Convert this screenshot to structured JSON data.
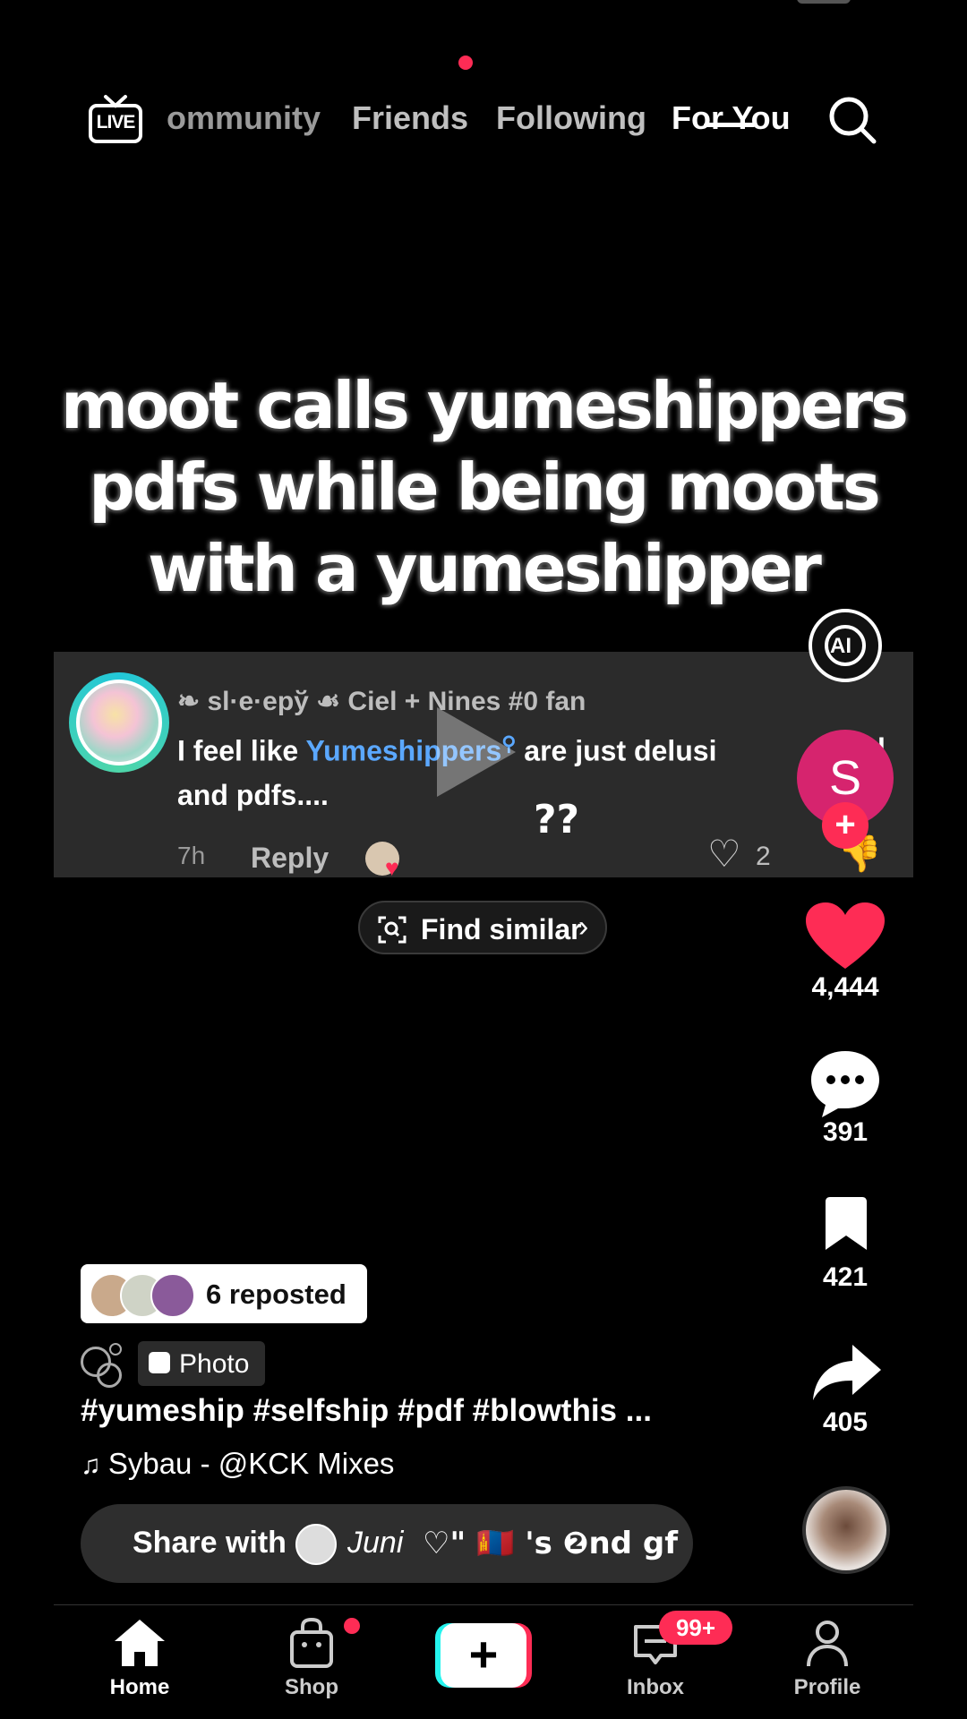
{
  "topnav": {
    "live_label": "LIVE",
    "tabs": [
      "ommunity",
      "Friends",
      "Following",
      "For You"
    ],
    "active_tab": "For You"
  },
  "caption": "moot calls yumeshippers pdfs while being moots with a yumeshipper",
  "comment": {
    "username": "❧ sl·e·epў ☙ Ciel + Nines #0 fan",
    "text_before": "I feel like ",
    "highlight": "Yumeshippers",
    "text_after": " are just delusi",
    "text_tail": "l",
    "line2": "and pdfs....",
    "time": "7h",
    "reply": "Reply",
    "likes": "2",
    "overlay_text": "??"
  },
  "ai_badge": "AI",
  "find_similar": "Find similar",
  "creator_avatar_letter": "S",
  "actions": {
    "likes": "4,444",
    "comments": "391",
    "saves": "421",
    "shares": "405"
  },
  "reposted": "6 reposted",
  "photo_badge": "Photo",
  "hashtags": "#yumeship #selfship #pdf #blowthis ...",
  "music": "Sybau - @KCK Mixes",
  "share": {
    "label": "Share with",
    "name": "Juni",
    "suffix": "♡\" 🇲🇳 's ❷nd gf"
  },
  "bottomnav": {
    "home": "Home",
    "shop": "Shop",
    "inbox": "Inbox",
    "inbox_badge": "99+",
    "profile": "Profile"
  },
  "colors": {
    "accent": "#fe2c55",
    "link": "#5ba8ff",
    "ring": "#22c7d8"
  }
}
